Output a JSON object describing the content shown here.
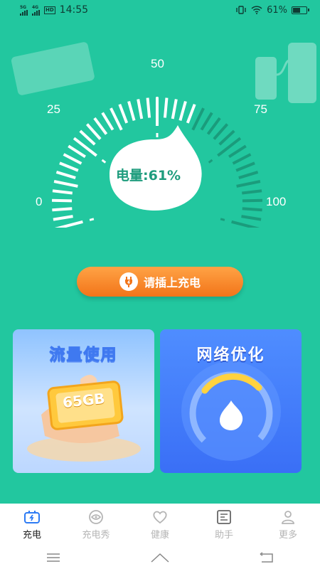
{
  "status_bar": {
    "signal_1": "5G",
    "signal_2": "4G",
    "hd_badge": "HD",
    "time": "14:55",
    "battery_text": "61%",
    "battery_level": 0.61
  },
  "gauge": {
    "scale_labels": [
      "0",
      "25",
      "50",
      "75",
      "100"
    ],
    "readout": "电量:61%",
    "value": 61,
    "max": 100
  },
  "charge_button": {
    "label": "请插上充电"
  },
  "cards": {
    "traffic": {
      "title": "流量使用",
      "badge": "65GB"
    },
    "network": {
      "title": "网络优化"
    }
  },
  "bottom_nav": {
    "items": [
      {
        "label": "充电",
        "icon": "battery-charge-icon",
        "active": true
      },
      {
        "label": "充电秀",
        "icon": "eye-icon",
        "active": false
      },
      {
        "label": "健康",
        "icon": "heart-icon",
        "active": false
      },
      {
        "label": "助手",
        "icon": "assistant-icon",
        "active": false
      },
      {
        "label": "更多",
        "icon": "person-icon",
        "active": false
      }
    ]
  },
  "colors": {
    "background": "#22C79F",
    "accent_orange": "#F27419",
    "bubble_text": "#1E9C7D",
    "card_blue": "#3A6FF6"
  }
}
